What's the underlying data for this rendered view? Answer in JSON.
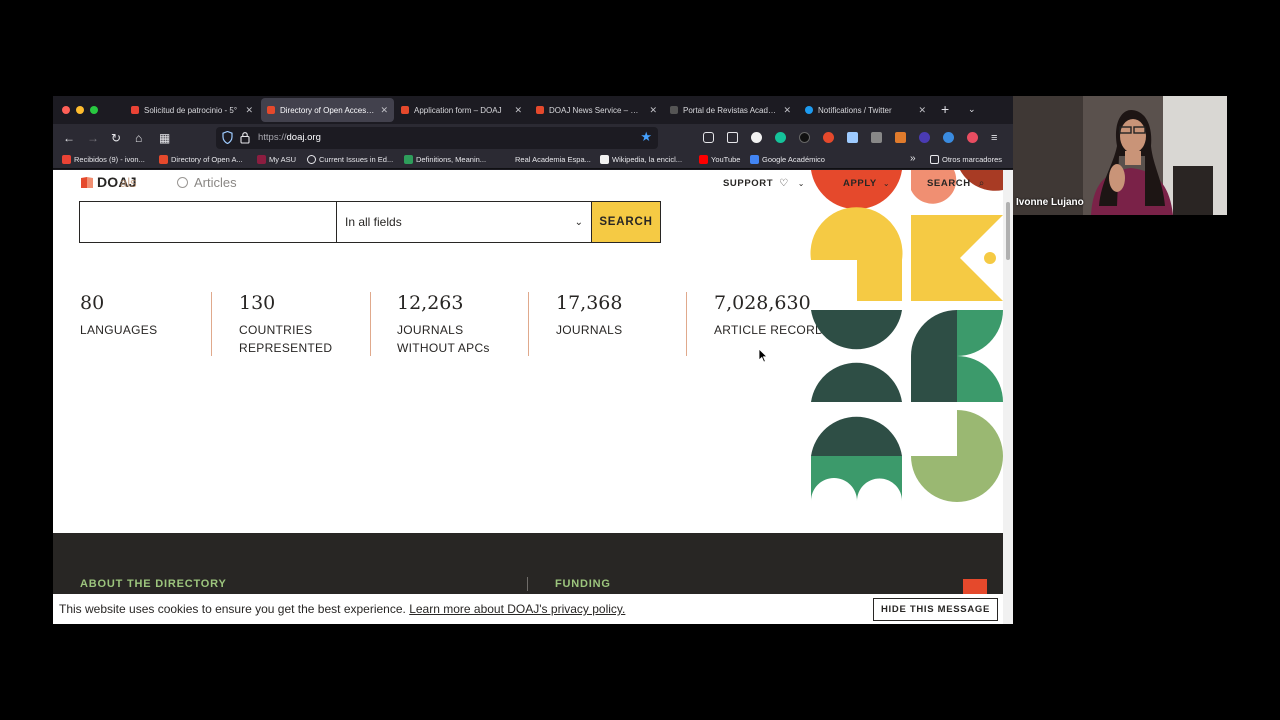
{
  "browser": {
    "tabs": [
      {
        "title": "Solicitud de patrocinio - 5°",
        "icon": "gmail-icon",
        "active": false
      },
      {
        "title": "Directory of Open Access J",
        "icon": "doaj-icon",
        "active": true
      },
      {
        "title": "Application form – DOAJ",
        "icon": "doaj-icon",
        "active": false
      },
      {
        "title": "DOAJ News Service – News",
        "icon": "doaj-icon",
        "active": false
      },
      {
        "title": "Portal de Revistas Académicas",
        "icon": "portal-icon",
        "active": false
      },
      {
        "title": "Notifications / Twitter",
        "icon": "twitter-icon",
        "active": false
      }
    ],
    "new_tab": "+",
    "tab_list": "⌄",
    "url": {
      "protocol": "https://",
      "host": "doaj.org"
    },
    "bookmarks": [
      {
        "label": "Recibidos (9) - ivon...",
        "icon": "gmail-icon"
      },
      {
        "label": "Directory of Open A...",
        "icon": "doaj-icon"
      },
      {
        "label": "My ASU",
        "icon": "asu-icon"
      },
      {
        "label": "Current Issues in Ed...",
        "icon": "globe-icon"
      },
      {
        "label": "Definitions, Meanin...",
        "icon": "lexico-icon"
      },
      {
        "label": "Real Academia Espa...",
        "icon": "rae-icon"
      },
      {
        "label": "Wikipedia, la encicl...",
        "icon": "wikipedia-icon"
      },
      {
        "label": "YouTube",
        "icon": "youtube-icon"
      },
      {
        "label": "Google Académico",
        "icon": "scholar-icon"
      }
    ],
    "bookmarks_overflow": "»",
    "other_bookmarks": "Otros marcadores"
  },
  "site": {
    "logo_text": "DOAJ",
    "logo_ghost_text": "als",
    "radio_articles": "Articles",
    "nav": {
      "support": "SUPPORT",
      "apply": "APPLY",
      "search": "SEARCH"
    },
    "search": {
      "field_select": "In all fields",
      "button": "SEARCH"
    },
    "stats": [
      {
        "value": "80",
        "label_lines": [
          "LANGUAGES"
        ]
      },
      {
        "value": "130",
        "label_lines": [
          "COUNTRIES",
          "REPRESENTED"
        ]
      },
      {
        "value": "12,263",
        "label_lines": [
          "JOURNALS",
          "WITHOUT APCs"
        ]
      },
      {
        "value": "17,368",
        "label_lines": [
          "JOURNALS"
        ]
      },
      {
        "value": "7,028,630",
        "label_lines": [
          "ARTICLE RECORDS"
        ]
      }
    ],
    "footer": {
      "about": "ABOUT THE DIRECTORY",
      "funding": "FUNDING"
    },
    "cookie": {
      "message": "This website uses cookies to ensure you get the best experience. ",
      "link": "Learn more about DOAJ's privacy policy.",
      "button": "HIDE THIS MESSAGE"
    }
  },
  "webcam": {
    "participant_name": "Ivonne Lujano"
  },
  "colors": {
    "doaj_red": "#e5492c",
    "doaj_yellow": "#f5ca44",
    "doaj_dark_green": "#2e4e45",
    "doaj_green": "#3c9a6b",
    "doaj_light_green": "#9ab872",
    "doaj_salmon": "#f08f72",
    "footer_bg": "#282624"
  }
}
